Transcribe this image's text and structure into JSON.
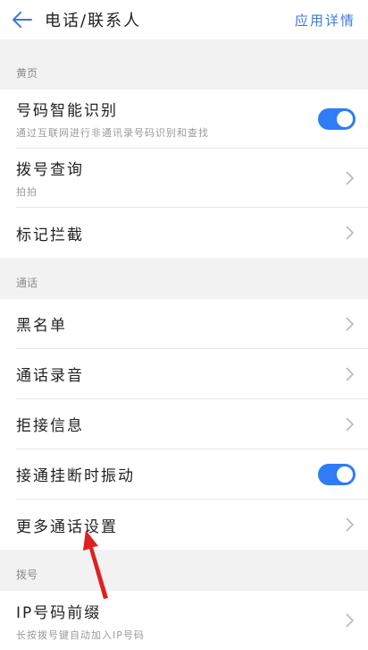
{
  "header": {
    "title": "电话/联系人",
    "app_details": "应用详情",
    "back_icon": "back-arrow-icon"
  },
  "sections": [
    {
      "label": "黄页",
      "items": [
        {
          "title": "号码智能识别",
          "subtitle": "通过互联网进行非通讯录号码识别和查找",
          "control": "toggle",
          "on": true
        },
        {
          "title": "拨号查询",
          "subtitle": "拍拍",
          "control": "chevron"
        },
        {
          "title": "标记拦截",
          "control": "chevron"
        }
      ]
    },
    {
      "label": "通话",
      "items": [
        {
          "title": "黑名单",
          "control": "chevron"
        },
        {
          "title": "通话录音",
          "control": "chevron"
        },
        {
          "title": "拒接信息",
          "control": "chevron"
        },
        {
          "title": "接通挂断时振动",
          "control": "toggle",
          "on": true
        },
        {
          "title": "更多通话设置",
          "control": "chevron"
        }
      ]
    },
    {
      "label": "拨号",
      "items": [
        {
          "title": "IP号码前缀",
          "subtitle": "长按拨号键自动加入IP号码",
          "control": "chevron"
        }
      ]
    }
  ],
  "colors": {
    "accent": "#2e7cf6",
    "link": "#3f7ad9",
    "annotation_arrow": "#e02020"
  }
}
